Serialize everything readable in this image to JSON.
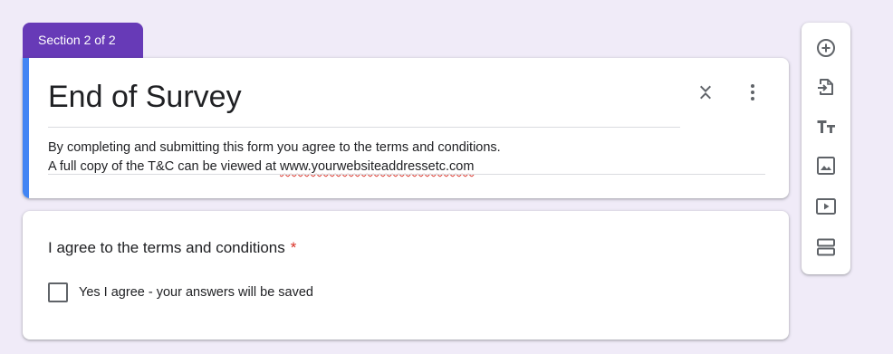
{
  "section_tab": {
    "label": "Section 2 of 2"
  },
  "header": {
    "title": "End of Survey",
    "description_line1": "By completing and submitting this form you agree to the terms and conditions.",
    "description_line2_prefix": "A full copy of the T&C can be viewed at ",
    "description_url": "www.yourwebsiteaddressetc.com",
    "collapse_icon": "collapse-icon",
    "more_icon": "more-vert-icon"
  },
  "question": {
    "title": "I agree to the terms and conditions",
    "required_marker": "*",
    "option_label": "Yes I agree -  your answers will be saved",
    "checked": false
  },
  "toolbar": {
    "items": [
      "add-question-icon",
      "import-questions-icon",
      "add-title-icon",
      "add-image-icon",
      "add-video-icon",
      "add-section-icon"
    ]
  },
  "colors": {
    "background": "#f0ebf8",
    "accent_purple": "#673ab7",
    "accent_blue": "#4285f4",
    "required_red": "#d93025"
  }
}
